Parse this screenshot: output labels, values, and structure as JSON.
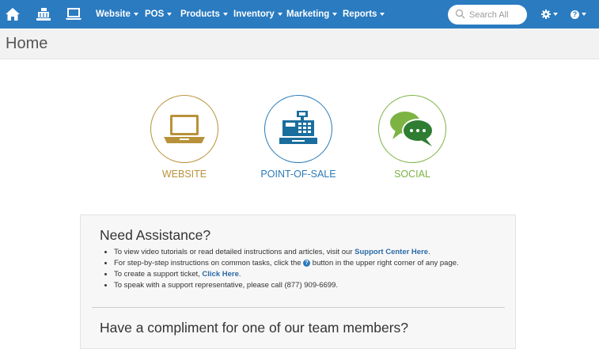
{
  "navbar": {
    "items": [
      {
        "label": "Website"
      },
      {
        "label": "POS"
      },
      {
        "label": "Products"
      },
      {
        "label": "Inventory"
      },
      {
        "label": "Marketing"
      },
      {
        "label": "Reports"
      }
    ],
    "search": {
      "placeholder": "Search All"
    }
  },
  "page": {
    "title": "Home"
  },
  "tiles": [
    {
      "label": "WEBSITE",
      "color": "#b8923a"
    },
    {
      "label": "POINT-OF-SALE",
      "color": "#2a7ab8"
    },
    {
      "label": "SOCIAL",
      "color": "#7cb342"
    }
  ],
  "assistance": {
    "heading": "Need Assistance?",
    "items": [
      {
        "text": "To view video tutorials or read detailed instructions and articles, visit our ",
        "link": "Support Center Here",
        "after": "."
      },
      {
        "text": "For step-by-step instructions on common tasks, click the ",
        "after": " button in the upper right corner of any page."
      },
      {
        "text": "To create a support ticket, ",
        "link": "Click Here",
        "after": "."
      },
      {
        "text": "To speak with a support representative, please call (877) 909-6699."
      }
    ]
  },
  "compliment": {
    "heading": "Have a compliment for one of our team members?"
  },
  "colors": {
    "navbar": "#2a7bc0",
    "link": "#2a6aa8"
  }
}
